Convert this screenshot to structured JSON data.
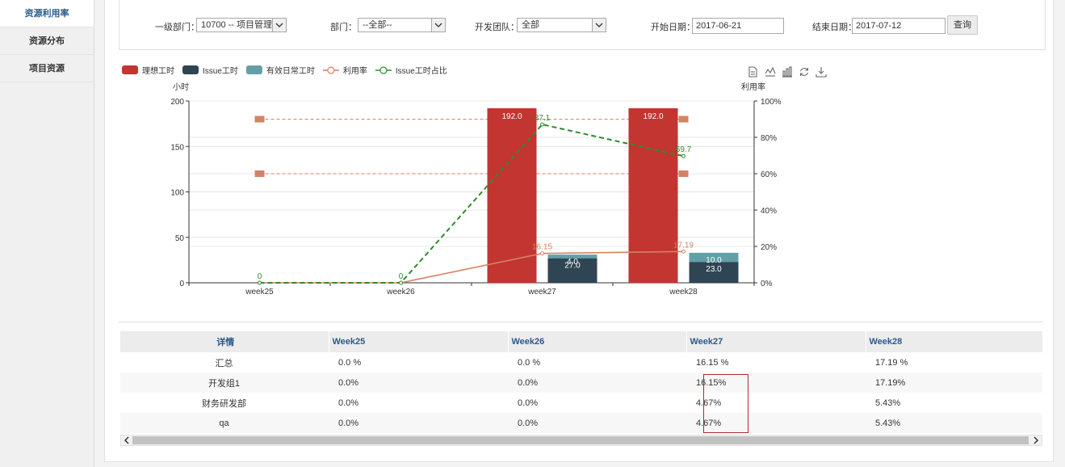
{
  "sidebar": {
    "items": [
      {
        "label": "资源利用率"
      },
      {
        "label": "资源分布"
      },
      {
        "label": "项目资源"
      }
    ]
  },
  "filters": {
    "dept1_label": "一级部门：",
    "dept1_value": "10700 -- 项目管理部",
    "dept_label": "部门：",
    "dept_value": "--全部--",
    "team_label": "开发团队：",
    "team_value": "全部",
    "start_label": "开始日期：",
    "start_value": "2017-06-21",
    "end_label": "结束日期：",
    "end_value": "2017-07-12",
    "query_label": "查询"
  },
  "toolbox_icons": [
    "data-view-icon",
    "line-chart-icon",
    "bar-chart-icon",
    "refresh-icon",
    "download-icon"
  ],
  "chart_data": {
    "type": "bar",
    "categories": [
      "week25",
      "week26",
      "week27",
      "week28"
    ],
    "left_axis": {
      "name": "小时",
      "min": 0,
      "max": 200,
      "ticks": [
        0,
        50,
        100,
        150,
        200
      ]
    },
    "right_axis": {
      "name": "利用率",
      "min": 0,
      "max": 100,
      "ticks": [
        "0%",
        "20%",
        "40%",
        "60%",
        "80%",
        "100%"
      ]
    },
    "legend": [
      {
        "name": "理想工时",
        "kind": "bar",
        "color": "#c23531"
      },
      {
        "name": "Issue工时",
        "kind": "bar",
        "color": "#2f4554"
      },
      {
        "name": "有效日常工时",
        "kind": "bar",
        "color": "#61a0a8"
      },
      {
        "name": "利用率",
        "kind": "line",
        "color": "#d48265"
      },
      {
        "name": "Issue工时占比",
        "kind": "line",
        "color": "#2e8b2e"
      }
    ],
    "series": [
      {
        "name": "理想工时",
        "values": [
          0,
          0,
          192.0,
          192.0
        ],
        "labels": [
          "",
          "",
          "192.0",
          "192.0"
        ]
      },
      {
        "name": "Issue工时",
        "values": [
          0,
          0,
          27.0,
          23.0
        ],
        "labels": [
          "",
          "",
          "27.0",
          "23.0"
        ]
      },
      {
        "name": "有效日常工时",
        "values": [
          0,
          0,
          4.0,
          10.0
        ],
        "labels": [
          "",
          "",
          "4.0",
          "10.0"
        ]
      },
      {
        "name": "利用率",
        "values": [
          0,
          0,
          16.15,
          17.19
        ],
        "labels": [
          "",
          "",
          "16.15",
          "17.19"
        ]
      },
      {
        "name": "Issue工时占比",
        "values": [
          0,
          0,
          87.1,
          69.7
        ],
        "labels": [
          "0",
          "0",
          "87.1",
          "69.7"
        ]
      }
    ],
    "reference_lines": [
      90,
      60
    ],
    "grid": true
  },
  "table": {
    "headers": [
      "详情",
      "Week25",
      "Week26",
      "Week27",
      "Week28"
    ],
    "rows": [
      [
        "汇总",
        "0.0 %",
        "0.0 %",
        "16.15 %",
        "17.19 %"
      ],
      [
        "开发组1",
        "0.0%",
        "0.0%",
        "16.15%",
        "17.19%"
      ],
      [
        "财务研发部",
        "0.0%",
        "0.0%",
        "4.67%",
        "5.43%"
      ],
      [
        "qa",
        "0.0%",
        "0.0%",
        "4.67%",
        "5.43%"
      ]
    ]
  }
}
